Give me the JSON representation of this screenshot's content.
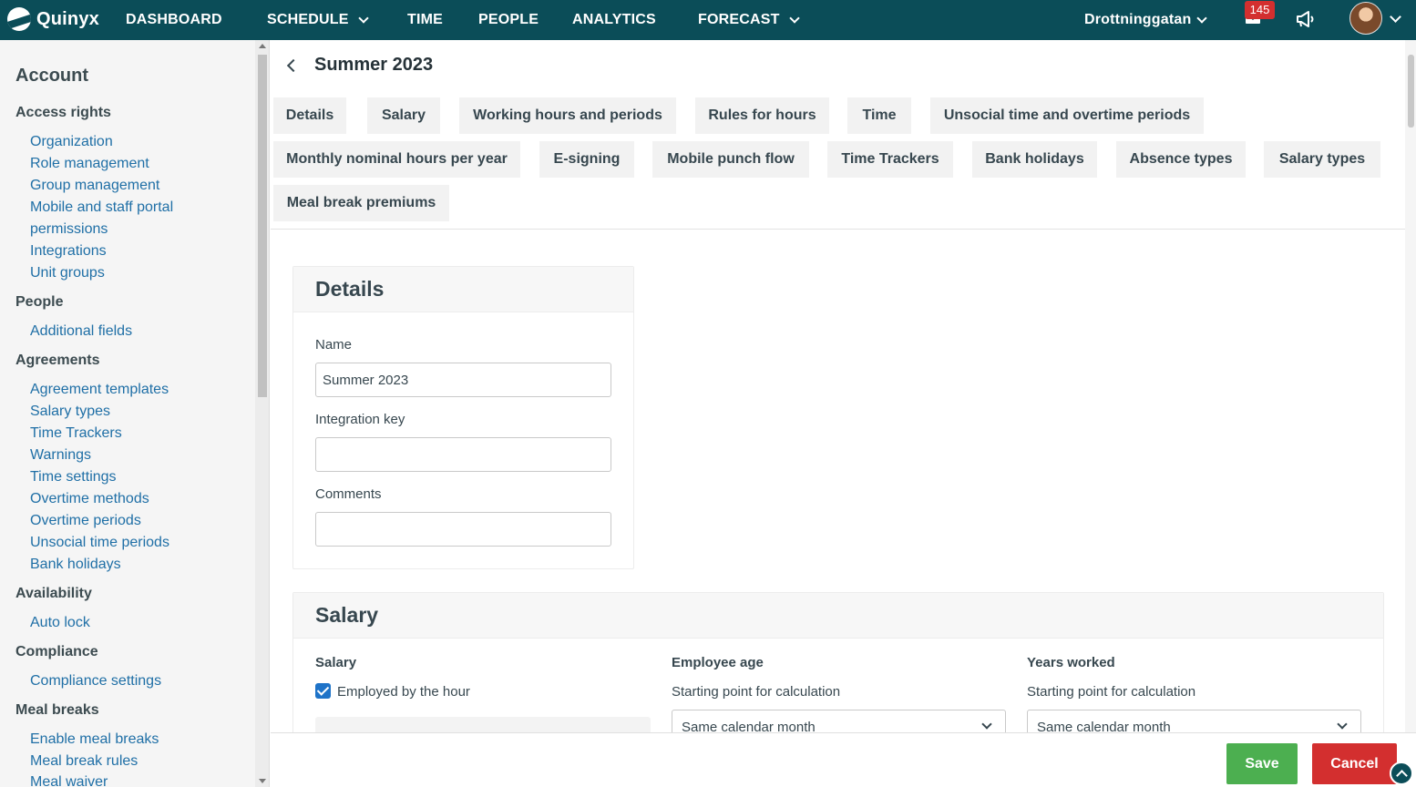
{
  "brand": {
    "name": "Quinyx",
    "color": "#0b4d58"
  },
  "nav": {
    "items": [
      "DASHBOARD",
      "SCHEDULE",
      "TIME",
      "PEOPLE",
      "ANALYTICS",
      "FORECAST"
    ],
    "unit": "Drottninggatan",
    "notification_count": "145"
  },
  "sidebar": {
    "title": "Account",
    "groups": [
      {
        "label": "Access rights",
        "links": [
          "Organization",
          "Role management",
          "Group management",
          "Mobile and staff portal",
          "permissions",
          "Integrations",
          "Unit groups"
        ]
      },
      {
        "label": "People",
        "links": [
          "Additional fields"
        ]
      },
      {
        "label": "Agreements",
        "links": [
          "Agreement templates",
          "Salary types",
          "Time Trackers",
          "Warnings",
          "Time settings",
          "Overtime methods",
          "Overtime periods",
          "Unsocial time periods",
          "Bank holidays"
        ]
      },
      {
        "label": "Availability",
        "links": [
          "Auto lock"
        ]
      },
      {
        "label": "Compliance",
        "links": [
          "Compliance settings"
        ]
      },
      {
        "label": "Meal breaks",
        "links": [
          "Enable meal breaks",
          "Meal break rules",
          "Meal waiver"
        ]
      }
    ]
  },
  "page": {
    "title": "Summer 2023",
    "tabs": [
      "Details",
      "Salary",
      "Working hours and periods",
      "Rules for hours",
      "Time",
      "Unsocial time and overtime periods",
      "Monthly nominal hours per year",
      "E-signing",
      "Mobile punch flow",
      "Time Trackers",
      "Bank holidays",
      "Absence types",
      "Salary types",
      "Meal break premiums"
    ]
  },
  "details": {
    "heading": "Details",
    "name_label": "Name",
    "name_value": "Summer 2023",
    "integration_label": "Integration key",
    "integration_value": "",
    "comments_label": "Comments",
    "comments_value": ""
  },
  "salary": {
    "heading": "Salary",
    "salary_sub": "Salary",
    "employed_by_hour": "Employed by the hour",
    "age_sub": "Employee age",
    "age_calc_label": "Starting point for calculation",
    "age_calc_value": "Same calendar month",
    "years_sub": "Years worked",
    "years_calc_label": "Starting point for calculation",
    "years_calc_value": "Same calendar month"
  },
  "footer": {
    "save": "Save",
    "cancel": "Cancel"
  },
  "colors": {
    "save": "#4caf50",
    "cancel": "#d32f2f",
    "link": "#1f6fa6",
    "badge": "#d32f2f"
  }
}
